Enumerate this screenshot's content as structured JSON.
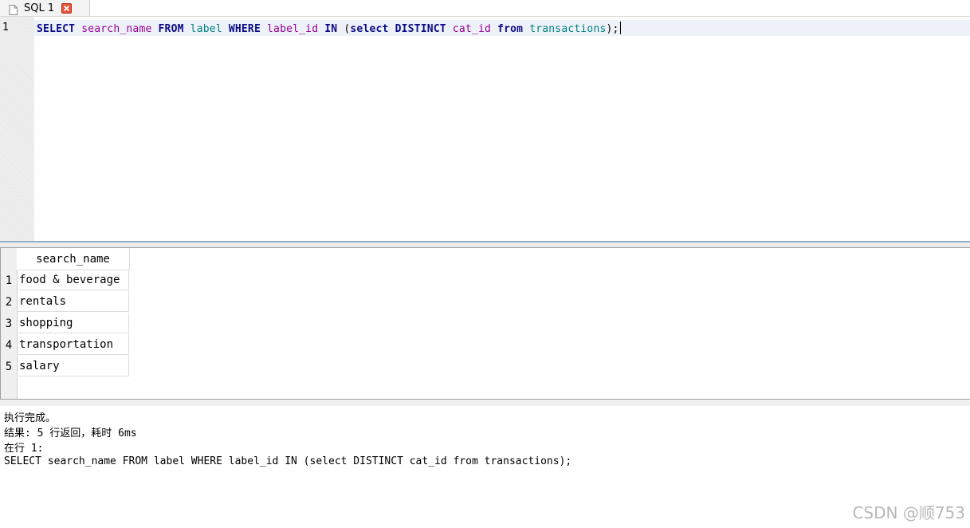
{
  "tab": {
    "label": "SQL 1"
  },
  "editor": {
    "line_number": "1",
    "tokens": {
      "t1": "SELECT",
      "t2": "search_name",
      "t3": "FROM",
      "t4": "label",
      "t5": "WHERE",
      "t6": "label_id",
      "t7": "IN",
      "t8": "(",
      "t9": "select",
      "t10": "DISTINCT",
      "t11": "cat_id",
      "t12": "from",
      "t13": "transactions",
      "t14": ");"
    }
  },
  "results": {
    "column": "search_name",
    "rows": [
      {
        "num": "1",
        "value": "food & beverage"
      },
      {
        "num": "2",
        "value": "rentals"
      },
      {
        "num": "3",
        "value": "shopping"
      },
      {
        "num": "4",
        "value": "transportation"
      },
      {
        "num": "5",
        "value": "salary"
      }
    ]
  },
  "messages": {
    "line1": "执行完成。",
    "line2": "结果: 5 行返回，耗时 6ms",
    "line3": "在行 1:",
    "line4": "SELECT search_name FROM label WHERE label_id IN (select DISTINCT cat_id from transactions);"
  },
  "watermark": "CSDN @顺753",
  "colors": {
    "keyword": "#0b0b88",
    "identifier_purple": "#990099",
    "identifier_teal": "#008080",
    "close_button": "#e8523a"
  }
}
